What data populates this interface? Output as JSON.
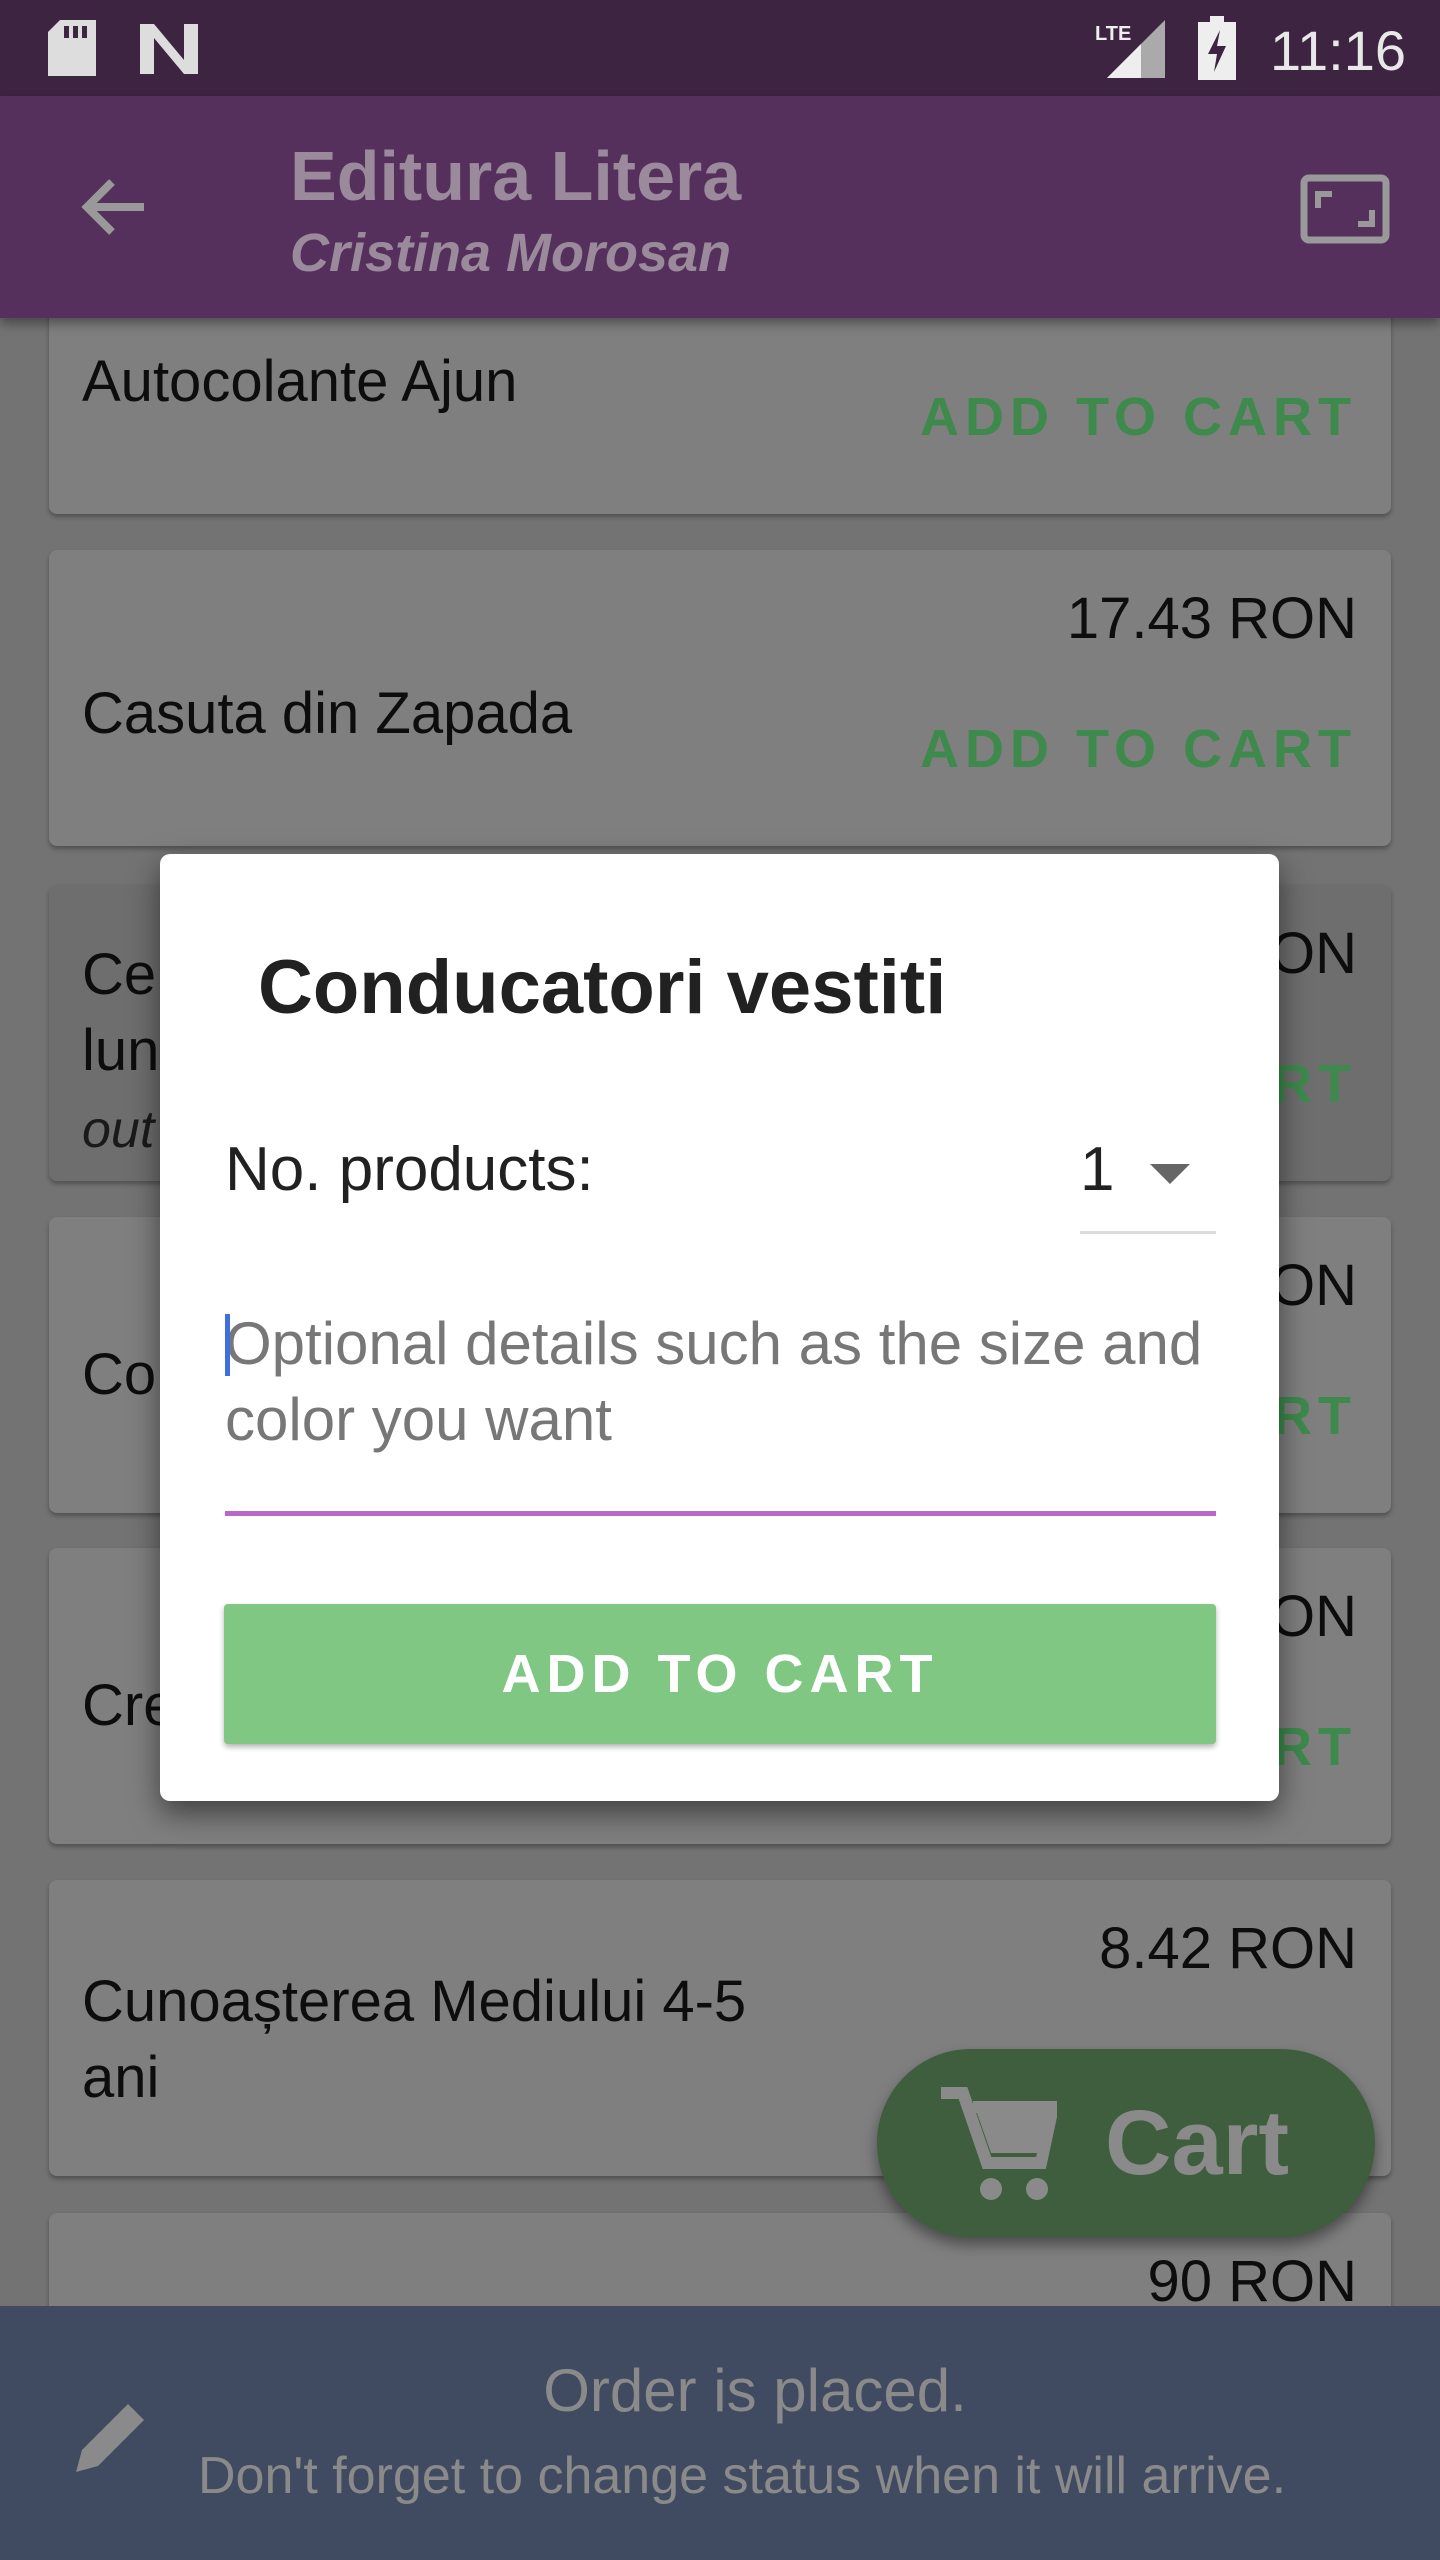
{
  "status_bar": {
    "time": "11:16",
    "icons": [
      "sd-card-icon",
      "n-icon",
      "lte-signal-icon",
      "battery-charging-icon"
    ]
  },
  "app_bar": {
    "title": "Editura Litera",
    "subtitle": "Cristina Morosan",
    "back_icon": "arrow-left-icon",
    "action_icon": "fullscreen-icon"
  },
  "products": [
    {
      "name": "Autocolante Ajun",
      "price": "",
      "action": "ADD TO CART"
    },
    {
      "name": "Casuta din Zapada",
      "price": "17.43 RON",
      "action": "ADD TO CART"
    },
    {
      "name": "Ce\nlun",
      "price": "ON",
      "action": "RT",
      "status": "out"
    },
    {
      "name": "Co",
      "price": "ON",
      "action": "RT"
    },
    {
      "name": "Cre",
      "price": "ON",
      "action": "RT"
    },
    {
      "name": "Cunoașterea Mediului 4-5\nani",
      "price": "8.42 RON",
      "action": ""
    },
    {
      "name": "",
      "price": "90 RON",
      "action": ""
    }
  ],
  "fab": {
    "label": "Cart",
    "icon": "cart-icon"
  },
  "banner": {
    "title": "Order is placed.",
    "message": "Don't forget to change status when it will arrive.",
    "icon": "pencil-icon"
  },
  "dialog": {
    "title": "Conducatori vestiti",
    "quantity_label": "No. products:",
    "quantity_value": "1",
    "details_placeholder": "Optional details such as the size and color you want",
    "button": "ADD TO CART",
    "colors": {
      "button": "#81c784",
      "input_underline": "#ba68c8"
    }
  }
}
